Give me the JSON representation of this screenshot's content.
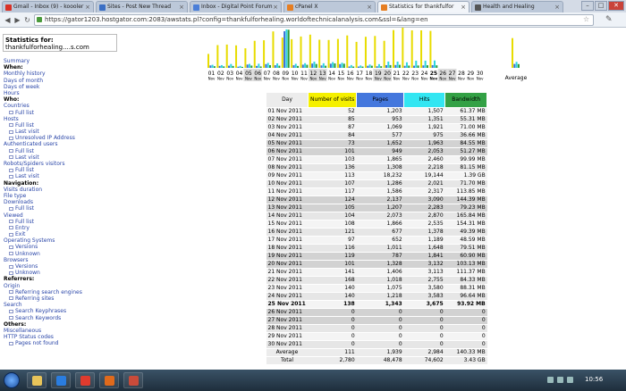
{
  "browser": {
    "tabs": [
      {
        "label": "Gmail - Inbox (9) - koooler",
        "color": "#d93025"
      },
      {
        "label": "Sites - Post New Thread",
        "color": "#3a6ec4"
      },
      {
        "label": "Inbox - Digital Point Forum",
        "color": "#4a7ed8"
      },
      {
        "label": "cPanel X",
        "color": "#e67e22"
      },
      {
        "label": "Statistics for thankfulfor",
        "color": "#e67e22"
      },
      {
        "label": "Health and Healing",
        "color": "#555555"
      }
    ],
    "url": "https://gator1203.hostgator.com:2083/awstats.pl?config=thankfulforhealing.worldoftechnicalanalysis.com&ssl=&lang=en"
  },
  "menu": {
    "stats_for_label": "Statistics for:",
    "stats_for_site": "thankfulforhealing....s.com",
    "items": [
      {
        "text": "Summary",
        "level": "link"
      },
      {
        "text": "When:",
        "level": "head"
      },
      {
        "text": "Monthly history",
        "level": "link"
      },
      {
        "text": "Days of month",
        "level": "link"
      },
      {
        "text": "Days of week",
        "level": "link"
      },
      {
        "text": "Hours",
        "level": "link"
      },
      {
        "text": "Who:",
        "level": "head"
      },
      {
        "text": "Countries",
        "level": "link"
      },
      {
        "text": "Full list",
        "level": "sub"
      },
      {
        "text": "Hosts",
        "level": "link"
      },
      {
        "text": "Full list",
        "level": "sub"
      },
      {
        "text": "Last visit",
        "level": "sub"
      },
      {
        "text": "Unresolved IP Address",
        "level": "sub"
      },
      {
        "text": "Authenticated users",
        "level": "link"
      },
      {
        "text": "Full list",
        "level": "sub"
      },
      {
        "text": "Last visit",
        "level": "sub"
      },
      {
        "text": "Robots/Spiders visitors",
        "level": "link"
      },
      {
        "text": "Full list",
        "level": "sub"
      },
      {
        "text": "Last visit",
        "level": "sub"
      },
      {
        "text": "Navigation:",
        "level": "head"
      },
      {
        "text": "Visits duration",
        "level": "link"
      },
      {
        "text": "File type",
        "level": "link"
      },
      {
        "text": "Downloads",
        "level": "link"
      },
      {
        "text": "Full list",
        "level": "sub"
      },
      {
        "text": "Viewed",
        "level": "link"
      },
      {
        "text": "Full list",
        "level": "sub"
      },
      {
        "text": "Entry",
        "level": "sub"
      },
      {
        "text": "Exit",
        "level": "sub"
      },
      {
        "text": "Operating Systems",
        "level": "link"
      },
      {
        "text": "Versions",
        "level": "sub"
      },
      {
        "text": "Unknown",
        "level": "sub"
      },
      {
        "text": "Browsers",
        "level": "link"
      },
      {
        "text": "Versions",
        "level": "sub"
      },
      {
        "text": "Unknown",
        "level": "sub"
      },
      {
        "text": "Referrers:",
        "level": "head"
      },
      {
        "text": "Origin",
        "level": "link"
      },
      {
        "text": "Referring search engines",
        "level": "sub"
      },
      {
        "text": "Referring sites",
        "level": "sub"
      },
      {
        "text": "Search",
        "level": "link"
      },
      {
        "text": "Search Keyphrases",
        "level": "sub"
      },
      {
        "text": "Search Keywords",
        "level": "sub"
      },
      {
        "text": "Others:",
        "level": "head"
      },
      {
        "text": "Miscellaneous",
        "level": "link"
      },
      {
        "text": "HTTP Status codes",
        "level": "link"
      },
      {
        "text": "Pages not found",
        "level": "sub"
      }
    ]
  },
  "table": {
    "headers": {
      "day": "Day",
      "visits": "Number of visits",
      "pages": "Pages",
      "hits": "Hits",
      "bandwidth": "Bandwidth"
    },
    "rows": [
      [
        "01 Nov 2011",
        "52",
        "1,203",
        "1,507",
        "61.37 MB"
      ],
      [
        "02 Nov 2011",
        "85",
        "953",
        "1,351",
        "55.31 MB"
      ],
      [
        "03 Nov 2011",
        "87",
        "1,069",
        "1,921",
        "71.00 MB"
      ],
      [
        "04 Nov 2011",
        "84",
        "577",
        "975",
        "36.66 MB"
      ],
      [
        "05 Nov 2011",
        "73",
        "1,652",
        "1,963",
        "84.55 MB"
      ],
      [
        "06 Nov 2011",
        "101",
        "949",
        "2,053",
        "51.27 MB"
      ],
      [
        "07 Nov 2011",
        "103",
        "1,865",
        "2,460",
        "99.99 MB"
      ],
      [
        "08 Nov 2011",
        "136",
        "1,308",
        "2,218",
        "81.15 MB"
      ],
      [
        "09 Nov 2011",
        "113",
        "18,232",
        "19,144",
        "1.39 GB"
      ],
      [
        "10 Nov 2011",
        "107",
        "1,286",
        "2,021",
        "71.70 MB"
      ],
      [
        "11 Nov 2011",
        "117",
        "1,586",
        "2,317",
        "113.85 MB"
      ],
      [
        "12 Nov 2011",
        "124",
        "2,137",
        "3,090",
        "144.39 MB"
      ],
      [
        "13 Nov 2011",
        "105",
        "1,207",
        "2,283",
        "79.23 MB"
      ],
      [
        "14 Nov 2011",
        "104",
        "2,073",
        "2,870",
        "165.84 MB"
      ],
      [
        "15 Nov 2011",
        "108",
        "1,866",
        "2,535",
        "154.31 MB"
      ],
      [
        "16 Nov 2011",
        "121",
        "677",
        "1,378",
        "49.39 MB"
      ],
      [
        "17 Nov 2011",
        "97",
        "652",
        "1,189",
        "48.59 MB"
      ],
      [
        "18 Nov 2011",
        "116",
        "1,011",
        "1,648",
        "79.51 MB"
      ],
      [
        "19 Nov 2011",
        "119",
        "787",
        "1,841",
        "60.90 MB"
      ],
      [
        "20 Nov 2011",
        "101",
        "1,328",
        "3,132",
        "103.13 MB"
      ],
      [
        "21 Nov 2011",
        "141",
        "1,406",
        "3,113",
        "111.37 MB"
      ],
      [
        "22 Nov 2011",
        "168",
        "1,018",
        "2,755",
        "84.33 MB"
      ],
      [
        "23 Nov 2011",
        "140",
        "1,075",
        "3,580",
        "88.31 MB"
      ],
      [
        "24 Nov 2011",
        "140",
        "1,218",
        "3,583",
        "96.64 MB"
      ],
      [
        "25 Nov 2011",
        "138",
        "1,343",
        "3,675",
        "93.92 MB"
      ],
      [
        "26 Nov 2011",
        "0",
        "0",
        "0",
        "0"
      ],
      [
        "27 Nov 2011",
        "0",
        "0",
        "0",
        "0"
      ],
      [
        "28 Nov 2011",
        "0",
        "0",
        "0",
        "0"
      ],
      [
        "29 Nov 2011",
        "0",
        "0",
        "0",
        "0"
      ],
      [
        "30 Nov 2011",
        "0",
        "0",
        "0",
        "0"
      ]
    ],
    "weekend_rows": [
      4,
      5,
      11,
      12,
      18,
      19,
      25,
      26
    ],
    "today_row": 24,
    "average": [
      "Average",
      "111",
      "1,939",
      "2,984",
      "140.33 MB"
    ],
    "total": [
      "Total",
      "2,780",
      "48,478",
      "74,602",
      "3.43 GB"
    ]
  },
  "chart_data": {
    "type": "bar",
    "categories": [
      "01",
      "02",
      "03",
      "04",
      "05",
      "06",
      "07",
      "08",
      "09",
      "10",
      "11",
      "12",
      "13",
      "14",
      "15",
      "16",
      "17",
      "18",
      "19",
      "20",
      "21",
      "22",
      "23",
      "24",
      "25",
      "26",
      "27",
      "28",
      "29",
      "30"
    ],
    "month_label": "Nov",
    "average_label": "Average",
    "series": [
      {
        "name": "Number of visits",
        "color": "#e8dc00",
        "values": [
          52,
          85,
          87,
          84,
          73,
          101,
          103,
          136,
          113,
          107,
          117,
          124,
          105,
          104,
          108,
          121,
          97,
          116,
          119,
          101,
          141,
          168,
          140,
          140,
          138,
          0,
          0,
          0,
          0,
          0
        ],
        "average": 111
      },
      {
        "name": "Pages",
        "color": "#3b6fd6",
        "values": [
          1203,
          953,
          1069,
          577,
          1652,
          949,
          1865,
          1308,
          18232,
          1286,
          1586,
          2137,
          1207,
          2073,
          1866,
          677,
          652,
          1011,
          787,
          1328,
          1406,
          1018,
          1075,
          1218,
          1343,
          0,
          0,
          0,
          0,
          0
        ],
        "average": 1939
      },
      {
        "name": "Hits",
        "color": "#2fd6e0",
        "values": [
          1507,
          1351,
          1921,
          975,
          1963,
          2053,
          2460,
          2218,
          19144,
          2021,
          2317,
          3090,
          2283,
          2870,
          2535,
          1378,
          1189,
          1648,
          1841,
          3132,
          3113,
          2755,
          3580,
          3583,
          3675,
          0,
          0,
          0,
          0,
          0
        ],
        "average": 2984
      },
      {
        "name": "Bandwidth",
        "color": "#2a9a3a",
        "values": [
          61.37,
          55.31,
          71.0,
          36.66,
          84.55,
          51.27,
          99.99,
          81.15,
          1423,
          71.7,
          113.85,
          144.39,
          79.23,
          165.84,
          154.31,
          49.39,
          48.59,
          79.51,
          60.9,
          103.13,
          111.37,
          84.33,
          88.31,
          96.64,
          93.92,
          0,
          0,
          0,
          0,
          0
        ],
        "average": 140.33
      }
    ],
    "weekend_days": [
      "05",
      "06",
      "12",
      "13",
      "19",
      "20",
      "26",
      "27"
    ],
    "today": "25"
  },
  "taskbar": {
    "clock": "10:56",
    "apps": [
      {
        "name": "explorer-icon",
        "color": "#e8c45a"
      },
      {
        "name": "media-player-icon",
        "color": "#2a7de0"
      },
      {
        "name": "chrome-icon",
        "color": "#e03b2e"
      },
      {
        "name": "firefox-icon",
        "color": "#e06a1c"
      },
      {
        "name": "app-icon",
        "color": "#c94b3a"
      }
    ]
  }
}
